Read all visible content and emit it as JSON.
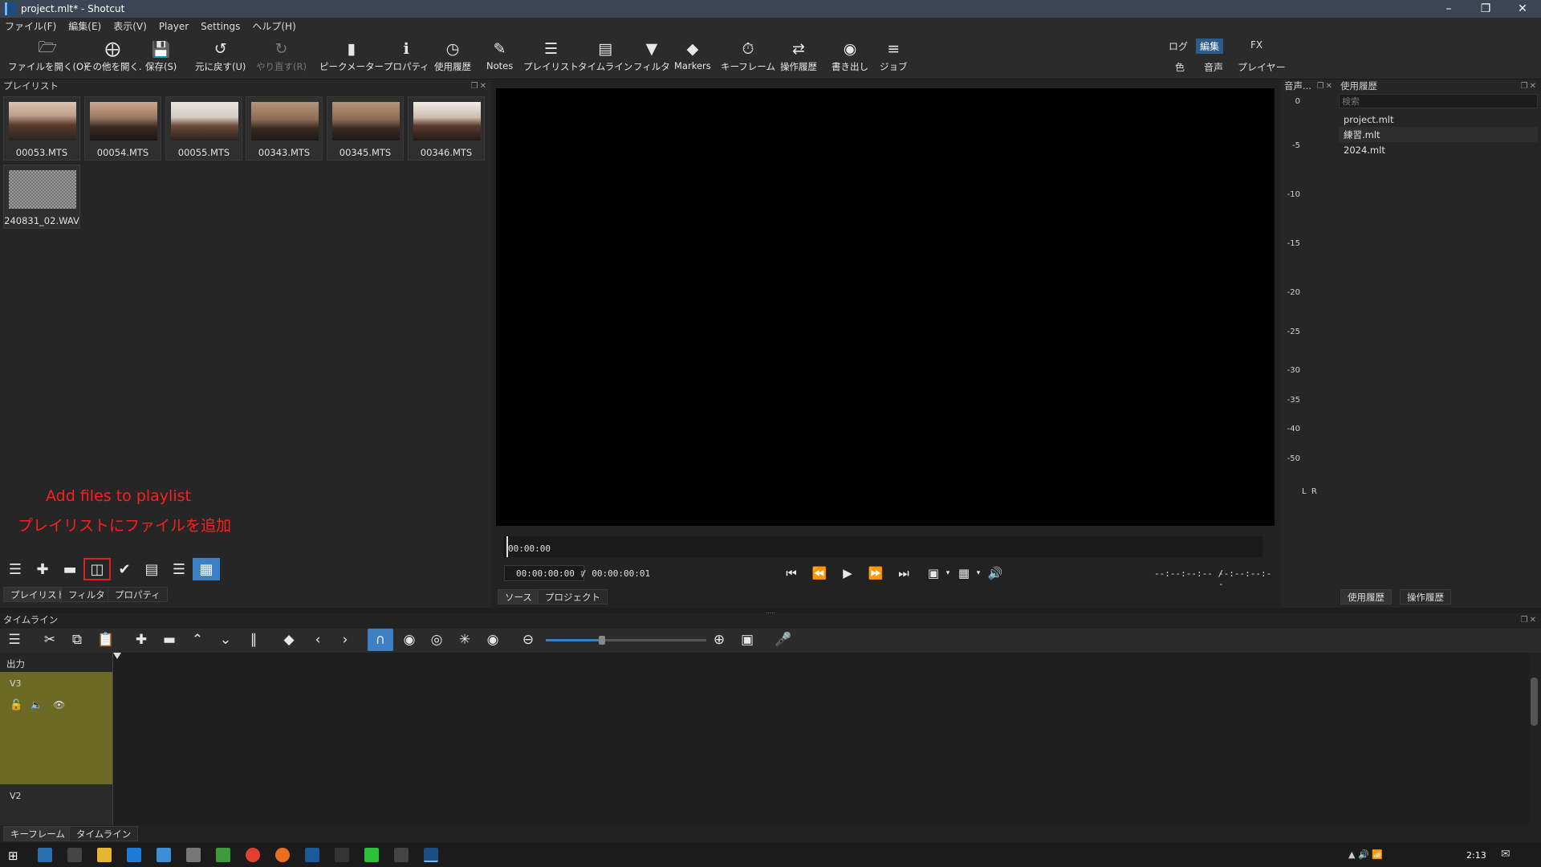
{
  "window": {
    "title": "project.mlt* - Shotcut"
  },
  "menu": [
    "ファイル(F)",
    "編集(E)",
    "表示(V)",
    "Player",
    "Settings",
    "ヘルプ(H)"
  ],
  "toolbar": {
    "open": "ファイルを開く(O)",
    "open_other": "その他を開く.",
    "save": "保存(S)",
    "undo": "元に戻す(U)",
    "redo": "やり直す(R)",
    "peak_meter": "ピークメーター",
    "properties": "プロパティ",
    "recent": "使用履歴",
    "notes": "Notes",
    "playlist": "プレイリスト",
    "timeline": "タイムライン",
    "filters": "フィルタ",
    "markers": "Markers",
    "keyframes": "キーフレーム",
    "history": "操作履歴",
    "export": "書き出し",
    "jobs": "ジョブ"
  },
  "workspaces": {
    "log": "ログ",
    "edit": "編集",
    "fx": "FX",
    "color": "色",
    "audio": "音声",
    "player": "プレイヤー"
  },
  "playlist": {
    "title": "プレイリスト",
    "items": [
      "00053.MTS",
      "00054.MTS",
      "00055.MTS",
      "00343.MTS",
      "00345.MTS",
      "00346.MTS",
      "240831_02.WAV"
    ],
    "tabs": [
      "プレイリスト",
      "フィルタ",
      "プロパティ"
    ]
  },
  "annotation": {
    "line1": "Add files to playlist",
    "line2": "プレイリストにファイルを追加"
  },
  "player": {
    "ruler_time": "00:00:00",
    "position": "00:00:00:00",
    "duration": "/ 00:00:00:01",
    "in_point": "--:--:--:-- /",
    "out_point": "--:--:--:--",
    "tabs": [
      "ソース",
      "プロジェクト"
    ]
  },
  "audio_meter": {
    "title": "音声...",
    "scale": [
      "0",
      "-5",
      "-10",
      "-15",
      "-20",
      "-25",
      "-30",
      "-35",
      "-40",
      "-50"
    ],
    "channels": "L  R"
  },
  "recent": {
    "title": "使用履歴",
    "search_placeholder": "検索",
    "items": [
      "project.mlt",
      "練習.mlt",
      "2024.mlt"
    ],
    "tabs": [
      "使用履歴",
      "操作履歴"
    ]
  },
  "timeline": {
    "title": "タイムライン",
    "output_label": "出力",
    "tracks": [
      "V3",
      "V2"
    ],
    "zoom_level": 0.35,
    "bottom_tabs": [
      "キーフレーム",
      "タイムライン"
    ]
  },
  "taskbar": {
    "clock": "2:13"
  },
  "colors": {
    "accent": "#3b7fc4",
    "track_selected": "#6b6a24",
    "annotation": "#ff1e1e"
  }
}
